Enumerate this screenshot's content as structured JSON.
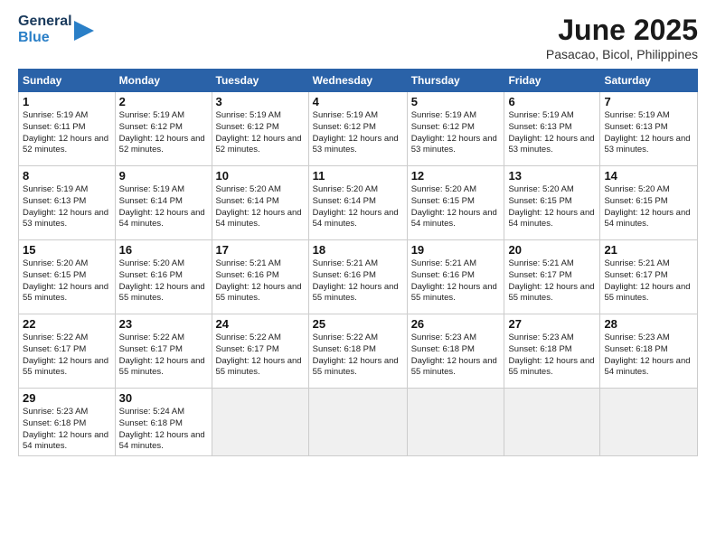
{
  "logo": {
    "line1": "General",
    "line2": "Blue"
  },
  "title": "June 2025",
  "subtitle": "Pasacao, Bicol, Philippines",
  "headers": [
    "Sunday",
    "Monday",
    "Tuesday",
    "Wednesday",
    "Thursday",
    "Friday",
    "Saturday"
  ],
  "weeks": [
    [
      {
        "day": "1",
        "rise": "5:19 AM",
        "set": "6:11 PM",
        "daylight": "12 hours and 52 minutes."
      },
      {
        "day": "2",
        "rise": "5:19 AM",
        "set": "6:12 PM",
        "daylight": "12 hours and 52 minutes."
      },
      {
        "day": "3",
        "rise": "5:19 AM",
        "set": "6:12 PM",
        "daylight": "12 hours and 52 minutes."
      },
      {
        "day": "4",
        "rise": "5:19 AM",
        "set": "6:12 PM",
        "daylight": "12 hours and 53 minutes."
      },
      {
        "day": "5",
        "rise": "5:19 AM",
        "set": "6:12 PM",
        "daylight": "12 hours and 53 minutes."
      },
      {
        "day": "6",
        "rise": "5:19 AM",
        "set": "6:13 PM",
        "daylight": "12 hours and 53 minutes."
      },
      {
        "day": "7",
        "rise": "5:19 AM",
        "set": "6:13 PM",
        "daylight": "12 hours and 53 minutes."
      }
    ],
    [
      {
        "day": "8",
        "rise": "5:19 AM",
        "set": "6:13 PM",
        "daylight": "12 hours and 53 minutes."
      },
      {
        "day": "9",
        "rise": "5:19 AM",
        "set": "6:14 PM",
        "daylight": "12 hours and 54 minutes."
      },
      {
        "day": "10",
        "rise": "5:20 AM",
        "set": "6:14 PM",
        "daylight": "12 hours and 54 minutes."
      },
      {
        "day": "11",
        "rise": "5:20 AM",
        "set": "6:14 PM",
        "daylight": "12 hours and 54 minutes."
      },
      {
        "day": "12",
        "rise": "5:20 AM",
        "set": "6:15 PM",
        "daylight": "12 hours and 54 minutes."
      },
      {
        "day": "13",
        "rise": "5:20 AM",
        "set": "6:15 PM",
        "daylight": "12 hours and 54 minutes."
      },
      {
        "day": "14",
        "rise": "5:20 AM",
        "set": "6:15 PM",
        "daylight": "12 hours and 54 minutes."
      }
    ],
    [
      {
        "day": "15",
        "rise": "5:20 AM",
        "set": "6:15 PM",
        "daylight": "12 hours and 55 minutes."
      },
      {
        "day": "16",
        "rise": "5:20 AM",
        "set": "6:16 PM",
        "daylight": "12 hours and 55 minutes."
      },
      {
        "day": "17",
        "rise": "5:21 AM",
        "set": "6:16 PM",
        "daylight": "12 hours and 55 minutes."
      },
      {
        "day": "18",
        "rise": "5:21 AM",
        "set": "6:16 PM",
        "daylight": "12 hours and 55 minutes."
      },
      {
        "day": "19",
        "rise": "5:21 AM",
        "set": "6:16 PM",
        "daylight": "12 hours and 55 minutes."
      },
      {
        "day": "20",
        "rise": "5:21 AM",
        "set": "6:17 PM",
        "daylight": "12 hours and 55 minutes."
      },
      {
        "day": "21",
        "rise": "5:21 AM",
        "set": "6:17 PM",
        "daylight": "12 hours and 55 minutes."
      }
    ],
    [
      {
        "day": "22",
        "rise": "5:22 AM",
        "set": "6:17 PM",
        "daylight": "12 hours and 55 minutes."
      },
      {
        "day": "23",
        "rise": "5:22 AM",
        "set": "6:17 PM",
        "daylight": "12 hours and 55 minutes."
      },
      {
        "day": "24",
        "rise": "5:22 AM",
        "set": "6:17 PM",
        "daylight": "12 hours and 55 minutes."
      },
      {
        "day": "25",
        "rise": "5:22 AM",
        "set": "6:18 PM",
        "daylight": "12 hours and 55 minutes."
      },
      {
        "day": "26",
        "rise": "5:23 AM",
        "set": "6:18 PM",
        "daylight": "12 hours and 55 minutes."
      },
      {
        "day": "27",
        "rise": "5:23 AM",
        "set": "6:18 PM",
        "daylight": "12 hours and 55 minutes."
      },
      {
        "day": "28",
        "rise": "5:23 AM",
        "set": "6:18 PM",
        "daylight": "12 hours and 54 minutes."
      }
    ],
    [
      {
        "day": "29",
        "rise": "5:23 AM",
        "set": "6:18 PM",
        "daylight": "12 hours and 54 minutes."
      },
      {
        "day": "30",
        "rise": "5:24 AM",
        "set": "6:18 PM",
        "daylight": "12 hours and 54 minutes."
      },
      {
        "day": "",
        "rise": "",
        "set": "",
        "daylight": ""
      },
      {
        "day": "",
        "rise": "",
        "set": "",
        "daylight": ""
      },
      {
        "day": "",
        "rise": "",
        "set": "",
        "daylight": ""
      },
      {
        "day": "",
        "rise": "",
        "set": "",
        "daylight": ""
      },
      {
        "day": "",
        "rise": "",
        "set": "",
        "daylight": ""
      }
    ]
  ]
}
